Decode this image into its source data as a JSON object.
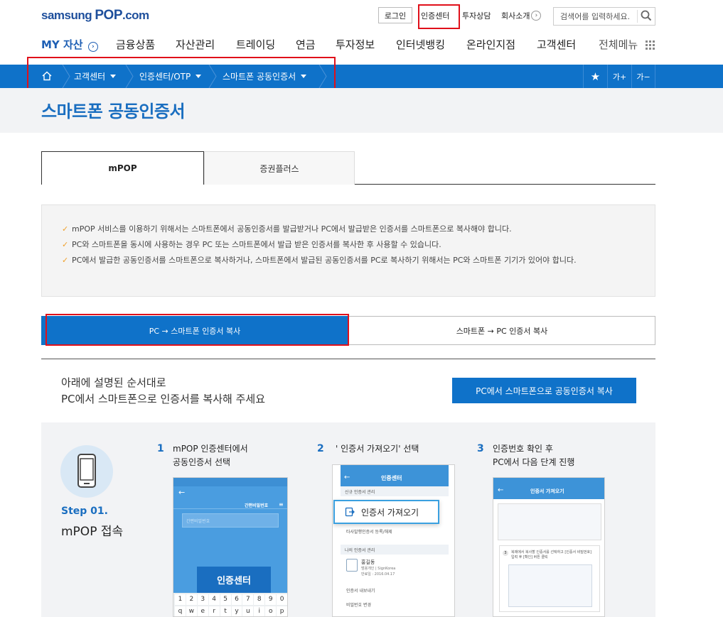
{
  "header": {
    "logo_samsung": "samsung",
    "logo_pop": "POP",
    "logo_domain": ".com",
    "login": "로그인",
    "cert_center": "인증센터",
    "consult": "투자상담",
    "company": "회사소개",
    "search_placeholder": "검색어를 입력하세요."
  },
  "nav": {
    "my_assets": "MY 자산",
    "items": [
      "금융상품",
      "자산관리",
      "트레이딩",
      "연금",
      "투자정보",
      "인터넷뱅킹",
      "온라인지점",
      "고객센터"
    ],
    "all_menu": "전체메뉴"
  },
  "breadcrumb": {
    "items": [
      "고객센터",
      "인증센터/OTP",
      "스마트폰 공동인증서"
    ],
    "font_up": "가+",
    "font_down": "가−"
  },
  "page": {
    "title": "스마트폰 공동인증서"
  },
  "tabs": [
    "mPOP",
    "증권플러스"
  ],
  "notice": [
    "mPOP 서비스를 이용하기 위해서는 스마트폰에서 공동인증서를 발급받거나 PC에서 발급받은 인증서를 스마트폰으로 복사해야 합니다.",
    "PC와 스마트폰을 동시에 사용하는 경우 PC 또는 스마트폰에서 발급 받은 인증서를 복사한 후 사용할 수 있습니다.",
    "PC에서 발급한 공동인증서를 스마트폰으로 복사하거나, 스마트폰에서 발급된 공동인증서를 PC로 복사하기 위해서는 PC와 스마트폰 기기가 있어야 합니다."
  ],
  "subtabs": [
    "PC → 스마트폰 인증서 복사",
    "스마트폰 → PC 인증서 복사"
  ],
  "intro": {
    "line1": "아래에 설명된 순서대로",
    "line2": "PC에서 스마트폰으로 인증서를 복사해 주세요",
    "cta": "PC에서 스마트폰으로 공동인증서 복사"
  },
  "step_block": {
    "label": "Step 01.",
    "title": "mPOP 접속"
  },
  "steps": [
    {
      "num": "1",
      "line1": "mPOP 인증센터에서",
      "line2": "공동인증서 선택"
    },
    {
      "num": "2",
      "line1": "' 인증서 가져오기' 선택",
      "line2": ""
    },
    {
      "num": "3",
      "line1": "인증번호 확인 후",
      "line2": "PC에서 다음 단계 진행"
    }
  ],
  "shot1": {
    "header_right": "간편비밀번호",
    "input_placeholder": "간편비밀번호",
    "popup": "인증센터",
    "keys_row1": [
      "1",
      "2",
      "3",
      "4",
      "5",
      "6",
      "7",
      "8",
      "9",
      "0"
    ],
    "keys_row2": [
      "q",
      "w",
      "e",
      "r",
      "t",
      "y",
      "u",
      "i",
      "o",
      "p"
    ]
  },
  "shot2": {
    "title": "인증센터",
    "section1": "신규 인증서 관리",
    "popup": "인증서 가져오기",
    "other_reg": "타사발행인증서 등록/해제",
    "section2": "나의 인증서 관리",
    "cert_name": "홍길동",
    "cert_detail": "범용개인 | SignKorea",
    "cert_date": "만료일 : 2016.04.17",
    "export": "인증서 내보내기",
    "pw_change": "비밀번호 변경"
  },
  "shot3": {
    "title": "인증서 가져오기",
    "step_num": "3",
    "instr": "복제에서 복사할 인증서를 선택하고 [인증서 비밀번호] 입력 후 [확인] 버튼 클릭"
  }
}
